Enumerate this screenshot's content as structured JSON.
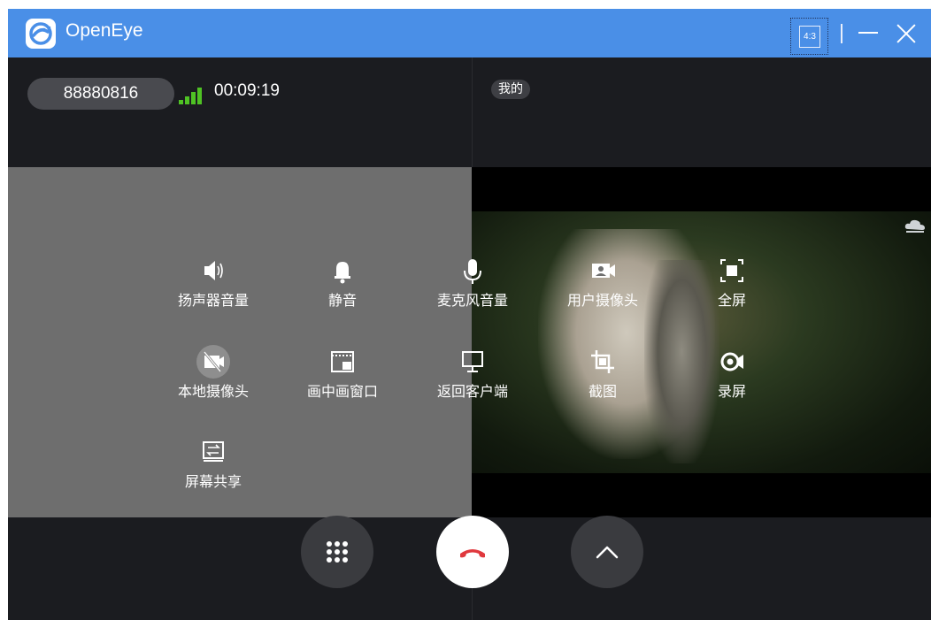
{
  "window": {
    "app_title": "OpenEye",
    "aspect_ratio_label": "4:3",
    "titlebar_color": "#4a8fe7",
    "background_color": "#1b1c20",
    "controls": {
      "minimize_icon": "minus-icon",
      "close_icon": "close-icon"
    }
  },
  "call": {
    "number": "88880816",
    "duration": "00:09:19",
    "signal_color": "#4fc224",
    "mine_label": "我的"
  },
  "menu": {
    "items": [
      {
        "label": "扬声器音量",
        "icon": "speaker-volume-icon"
      },
      {
        "label": "静音",
        "icon": "bell-mute-icon"
      },
      {
        "label": "麦克风音量",
        "icon": "microphone-icon"
      },
      {
        "label": "用户摄像头",
        "icon": "user-camera-icon"
      },
      {
        "label": "全屏",
        "icon": "fullscreen-icon"
      },
      {
        "label": "本地摄像头",
        "icon": "local-camera-off-icon"
      },
      {
        "label": "画中画窗口",
        "icon": "picture-in-picture-icon"
      },
      {
        "label": "返回客户端",
        "icon": "monitor-return-icon"
      },
      {
        "label": "截图",
        "icon": "crop-screenshot-icon"
      },
      {
        "label": "录屏",
        "icon": "record-screen-icon"
      },
      {
        "label": "屏幕共享",
        "icon": "screen-share-icon"
      }
    ]
  },
  "bottom_bar": {
    "grid_icon": "dialpad-grid-icon",
    "hangup_icon": "hangup-phone-icon",
    "hangup_color": "#e0393e",
    "expand_icon": "chevron-up-icon"
  }
}
